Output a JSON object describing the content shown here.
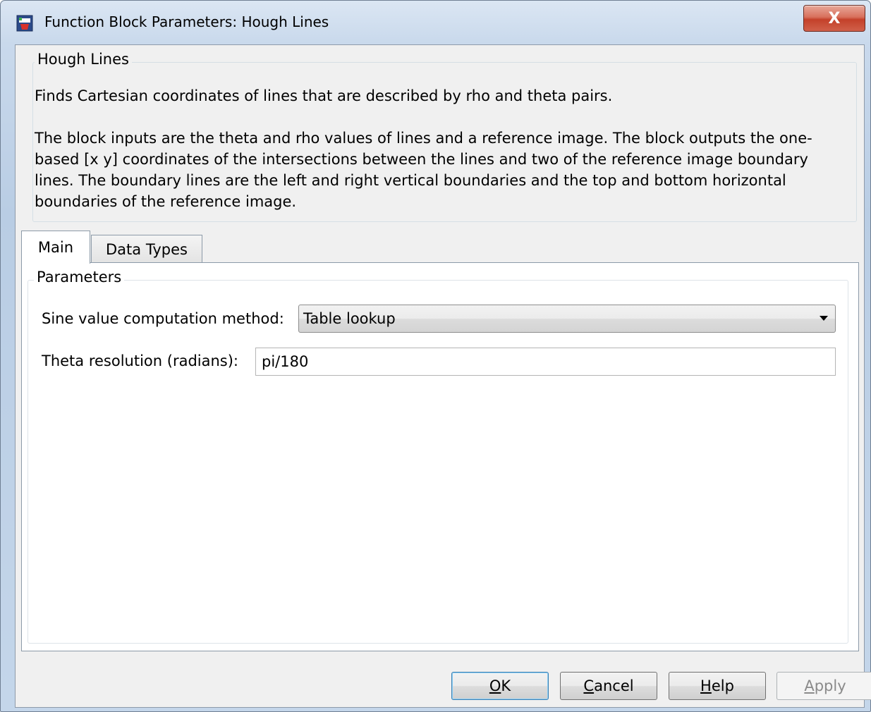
{
  "window": {
    "title": "Function Block Parameters: Hough Lines",
    "close_label": "X"
  },
  "description": {
    "group_title": "Hough Lines",
    "line1": "Finds Cartesian coordinates of lines that are described by rho and theta pairs.",
    "paragraph": "The block inputs are the theta and rho values of lines and a reference image. The block outputs the one-\nbased [x y] coordinates of the intersections between the lines and two of the reference image boundary\nlines. The boundary lines are the left and right vertical boundaries and the top and bottom horizontal\nboundaries of the reference image."
  },
  "tabs": [
    {
      "label": "Main",
      "selected": true
    },
    {
      "label": "Data Types",
      "selected": false
    }
  ],
  "parameters": {
    "group_title": "Parameters",
    "sine_method": {
      "label": "Sine value computation method:",
      "value": "Table lookup"
    },
    "theta_resolution": {
      "label": "Theta resolution (radians):",
      "value": "pi/180"
    }
  },
  "buttons": {
    "ok": {
      "mnemonic": "O",
      "rest": "K"
    },
    "cancel": {
      "mnemonic": "C",
      "rest": "ancel"
    },
    "help": {
      "mnemonic": "H",
      "rest": "elp"
    },
    "apply": {
      "mnemonic": "A",
      "rest": "pply",
      "enabled": false
    }
  },
  "icons": {
    "app": "simulink-block-icon",
    "close": "close-icon",
    "dropdown": "chevron-down-icon"
  }
}
